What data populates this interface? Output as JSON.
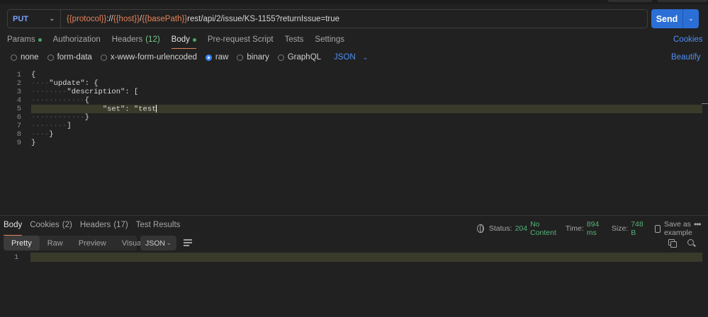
{
  "request": {
    "method": "PUT",
    "url_parts": [
      {
        "text": "{{protocol}}",
        "var": true
      },
      {
        "text": "://",
        "var": false
      },
      {
        "text": "{{host}}",
        "var": true
      },
      {
        "text": "/",
        "var": false
      },
      {
        "text": "{{basePath}}",
        "var": true
      },
      {
        "text": "rest/api/2/issue/KS-1155?returnIssue=true",
        "var": false
      }
    ],
    "send_label": "Send"
  },
  "request_tabs": [
    {
      "label": "Params",
      "dot": true,
      "count": "",
      "active": false
    },
    {
      "label": "Authorization",
      "dot": false,
      "count": "",
      "active": false
    },
    {
      "label": "Headers",
      "dot": false,
      "count": "(12)",
      "active": false
    },
    {
      "label": "Body",
      "dot": true,
      "count": "",
      "active": true
    },
    {
      "label": "Pre-request Script",
      "dot": false,
      "count": "",
      "active": false
    },
    {
      "label": "Tests",
      "dot": false,
      "count": "",
      "active": false
    },
    {
      "label": "Settings",
      "dot": false,
      "count": "",
      "active": false
    }
  ],
  "cookies_label": "Cookies",
  "body_types": [
    {
      "label": "none",
      "selected": false
    },
    {
      "label": "form-data",
      "selected": false
    },
    {
      "label": "x-www-form-urlencoded",
      "selected": false
    },
    {
      "label": "raw",
      "selected": true
    },
    {
      "label": "binary",
      "selected": false
    },
    {
      "label": "GraphQL",
      "selected": false
    }
  ],
  "raw_format": "JSON",
  "beautify_label": "Beautify",
  "editor_lines": [
    {
      "n": "1",
      "indent": "",
      "text": "{"
    },
    {
      "n": "2",
      "indent": "····",
      "text": "\"update\": {"
    },
    {
      "n": "3",
      "indent": "········",
      "text": "\"description\": ["
    },
    {
      "n": "4",
      "indent": "············",
      "text": "{"
    },
    {
      "n": "5",
      "indent": "                ",
      "text": "\"set\": \"test"
    },
    {
      "n": "6",
      "indent": "············",
      "text": "}"
    },
    {
      "n": "7",
      "indent": "········",
      "text": "]"
    },
    {
      "n": "8",
      "indent": "····",
      "text": "}"
    },
    {
      "n": "9",
      "indent": "",
      "text": "}"
    }
  ],
  "response_tabs": [
    {
      "label": "Body",
      "count": "",
      "active": true
    },
    {
      "label": "Cookies",
      "count": "(2)",
      "active": false
    },
    {
      "label": "Headers",
      "count": "(17)",
      "active": false
    },
    {
      "label": "Test Results",
      "count": "",
      "active": false
    }
  ],
  "response_status": {
    "status_label": "Status:",
    "status_value": "204",
    "status_text": "No Content",
    "time_label": "Time:",
    "time_value": "894 ms",
    "size_label": "Size:",
    "size_value": "748 B",
    "save_label": "Save as example"
  },
  "response_views": [
    "Pretty",
    "Raw",
    "Preview",
    "Visualize"
  ],
  "response_active_view": "Pretty",
  "response_format": "JSON",
  "response_line": "1",
  "icons": [
    "chevron-down-icon",
    "globe-icon",
    "save-icon",
    "more-icon",
    "wrap-lines-icon",
    "copy-icon",
    "search-icon"
  ],
  "colors": {
    "accent": "#e2825a",
    "send": "#2b6fd6",
    "link": "#4f8ff7",
    "ok": "#53b37a",
    "var": "#e5835a"
  }
}
